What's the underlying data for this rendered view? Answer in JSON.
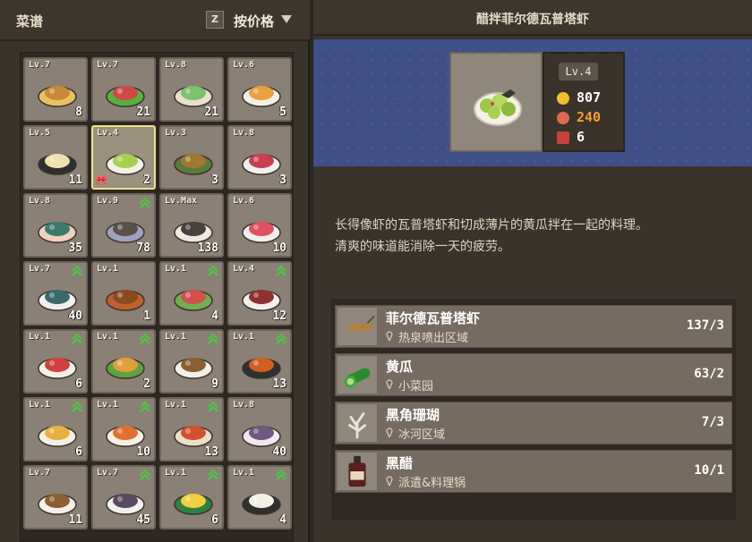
{
  "left": {
    "title": "菜谱",
    "sort_key": "Z",
    "sort_label": "按价格"
  },
  "grid": [
    {
      "lv": "Lv.7",
      "count": "8",
      "up": false
    },
    {
      "lv": "Lv.7",
      "count": "21",
      "up": false
    },
    {
      "lv": "Lv.8",
      "count": "21",
      "up": false
    },
    {
      "lv": "Lv.6",
      "count": "5",
      "up": false
    },
    {
      "lv": "Lv.5",
      "count": "11",
      "up": false
    },
    {
      "lv": "Lv.4",
      "count": "2",
      "up": false,
      "selected": true
    },
    {
      "lv": "Lv.3",
      "count": "3",
      "up": false
    },
    {
      "lv": "Lv.8",
      "count": "3",
      "up": false
    },
    {
      "lv": "Lv.8",
      "count": "35",
      "up": false
    },
    {
      "lv": "Lv.9",
      "count": "78",
      "up": true
    },
    {
      "lv": "Lv.Max",
      "count": "138",
      "up": false
    },
    {
      "lv": "Lv.6",
      "count": "10",
      "up": false
    },
    {
      "lv": "Lv.7",
      "count": "40",
      "up": true
    },
    {
      "lv": "Lv.1",
      "count": "1",
      "up": false
    },
    {
      "lv": "Lv.1",
      "count": "4",
      "up": true
    },
    {
      "lv": "Lv.4",
      "count": "12",
      "up": true
    },
    {
      "lv": "Lv.1",
      "count": "6",
      "up": true
    },
    {
      "lv": "Lv.1",
      "count": "2",
      "up": true
    },
    {
      "lv": "Lv.1",
      "count": "9",
      "up": true
    },
    {
      "lv": "Lv.1",
      "count": "13",
      "up": true
    },
    {
      "lv": "Lv.1",
      "count": "6",
      "up": true
    },
    {
      "lv": "Lv.1",
      "count": "10",
      "up": true
    },
    {
      "lv": "Lv.1",
      "count": "13",
      "up": true
    },
    {
      "lv": "Lv.8",
      "count": "40",
      "up": false
    },
    {
      "lv": "Lv.7",
      "count": "11",
      "up": false
    },
    {
      "lv": "Lv.7",
      "count": "45",
      "up": true
    },
    {
      "lv": "Lv.1",
      "count": "6",
      "up": true
    },
    {
      "lv": "Lv.1",
      "count": "4",
      "up": true
    }
  ],
  "detail": {
    "title": "醋拌菲尔德瓦普塔虾",
    "level": "Lv.4",
    "price": "807",
    "score": "240",
    "servings": "6",
    "description": "长得像虾的瓦普塔虾和切成薄片的黄瓜拌在一起的料理。\n清爽的味道能消除一天的疲劳。"
  },
  "ingredients": [
    {
      "name": "菲尔德瓦普塔虾",
      "location": "热泉喷出区域",
      "qty": "137/3",
      "icon": "shrimp-icon"
    },
    {
      "name": "黄瓜",
      "location": "小菜园",
      "qty": "63/2",
      "icon": "cucumber-icon"
    },
    {
      "name": "黑角珊瑚",
      "location": "冰河区域",
      "qty": "7/3",
      "icon": "coral-icon"
    },
    {
      "name": "黑醋",
      "location": "派遣&料理锅",
      "qty": "10/1",
      "icon": "vinegar-bottle-icon"
    }
  ],
  "colors": {
    "banner": "#3f5088",
    "gold": "#f0c030",
    "score": "#f0a030",
    "upgrade": "#52c04a"
  }
}
